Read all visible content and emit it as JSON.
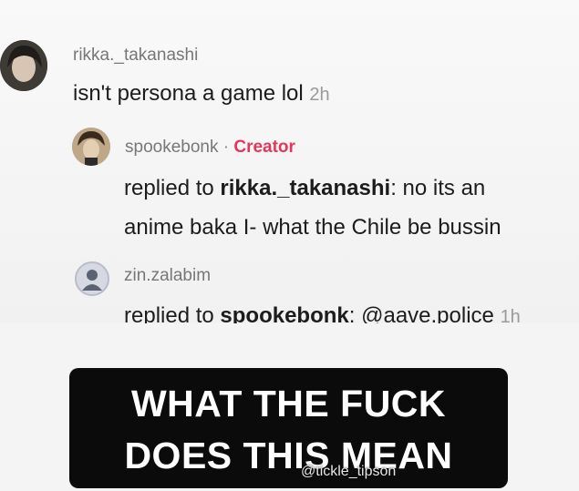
{
  "comments": [
    {
      "username": "rikka._takanashi",
      "text": "isn't persona a game lol",
      "time": "2h"
    },
    {
      "username": "spookebonk",
      "separator": "·",
      "badge": "Creator",
      "reply_prefix": "replied to ",
      "reply_target": "rikka._takanashi",
      "line1_rest": ": no its an",
      "line2": "anime baka I- what the Chile be bussin"
    },
    {
      "username": "zin.zalabim",
      "reply_prefix": "replied to ",
      "reply_target": "spookebonk",
      "line_rest": ": @aave.police",
      "time": "1h"
    }
  ],
  "caption": {
    "line1": "WHAT THE FUCK",
    "line2": "DOES THIS MEAN"
  },
  "watermark": "@tickle_tipson",
  "colors": {
    "creator_badge": "#e2375b",
    "caption_bg": "#0b0b0b"
  }
}
